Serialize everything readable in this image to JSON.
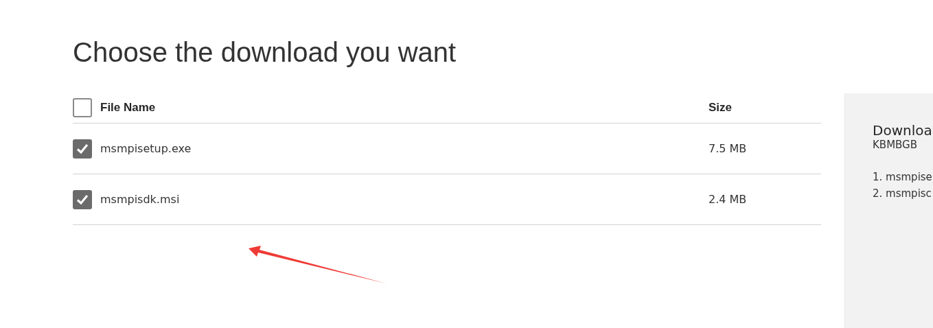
{
  "heading": "Choose the download you want",
  "table": {
    "select_all": {
      "checked": false
    },
    "columns": [
      "File Name",
      "Size"
    ],
    "rows": [
      {
        "name": "msmpisetup.exe",
        "size": "7.5 MB",
        "checked": true
      },
      {
        "name": "msmpisdk.msi",
        "size": "2.4 MB",
        "checked": true
      }
    ]
  },
  "summary_panel": {
    "title": "Downloa",
    "subtitle": "KBMBGB",
    "items": [
      "1. msmpise",
      "2. msmpisc"
    ]
  }
}
